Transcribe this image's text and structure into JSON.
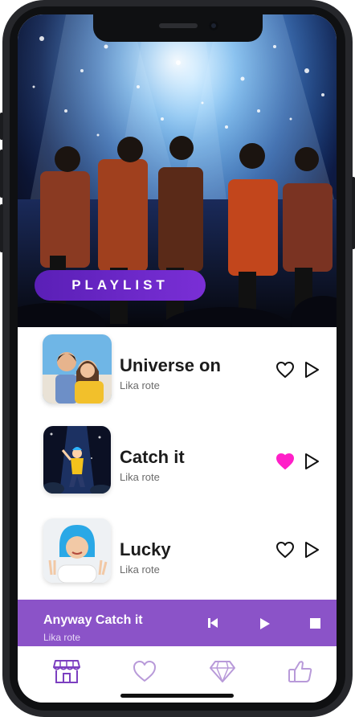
{
  "banner": {
    "label": "PLAYLIST"
  },
  "songs": [
    {
      "title": "Universe on",
      "artist": "Lika rote",
      "liked": false
    },
    {
      "title": "Catch it",
      "artist": "Lika rote",
      "liked": true
    },
    {
      "title": "Lucky",
      "artist": "Lika rote",
      "liked": false
    }
  ],
  "now_playing": {
    "title": "Anyway Catch it",
    "artist": "Lika rote"
  },
  "tabs": [
    {
      "icon": "store-icon",
      "active": true
    },
    {
      "icon": "heart-icon",
      "active": false
    },
    {
      "icon": "diamond-icon",
      "active": false
    },
    {
      "icon": "thumbs-up-icon",
      "active": false
    }
  ],
  "colors": {
    "accent": "#7a2fd6",
    "player_bg": "#8b53c8",
    "liked": "#ff1fc8",
    "tab_icon": "#7c3fc0"
  }
}
